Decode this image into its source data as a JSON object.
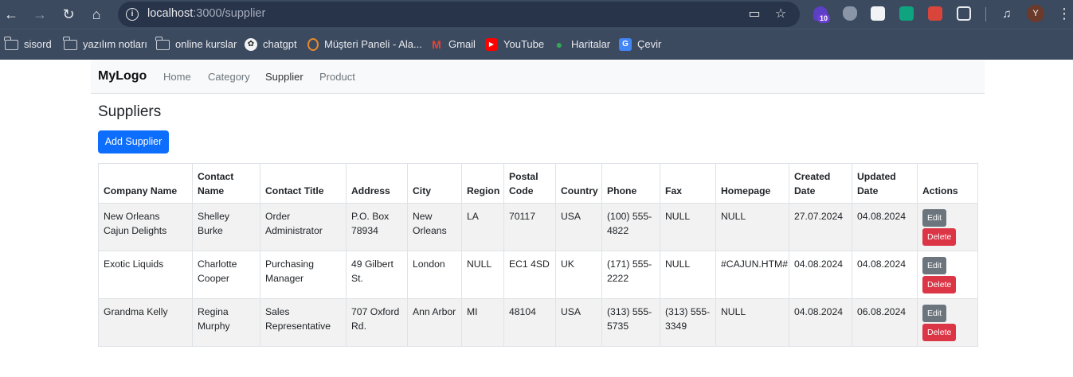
{
  "browser": {
    "url_host": "localhost",
    "url_port_path": ":3000/supplier",
    "extension_badge": "10",
    "profile_initial": "Y",
    "bookmarks": [
      {
        "label": "sisord",
        "icon": "folder-icon"
      },
      {
        "label": "yazılım notları",
        "icon": "folder-icon"
      },
      {
        "label": "online kurslar",
        "icon": "folder-icon"
      },
      {
        "label": "chatgpt",
        "icon": "chatgpt-icon"
      },
      {
        "label": "Müşteri Paneli - Ala...",
        "icon": "panel-icon"
      },
      {
        "label": "Gmail",
        "icon": "gmail-icon"
      },
      {
        "label": "YouTube",
        "icon": "youtube-icon"
      },
      {
        "label": "Haritalar",
        "icon": "maps-icon"
      },
      {
        "label": "Çevir",
        "icon": "translate-icon"
      }
    ]
  },
  "navbar": {
    "brand": "MyLogo",
    "links": [
      "Home",
      "Category",
      "Supplier",
      "Product"
    ],
    "active": "Supplier"
  },
  "page": {
    "title": "Suppliers",
    "add_button": "Add Supplier"
  },
  "table": {
    "headers": [
      "Company Name",
      "Contact Name",
      "Contact Title",
      "Address",
      "City",
      "Region",
      "Postal Code",
      "Country",
      "Phone",
      "Fax",
      "Homepage",
      "Created Date",
      "Updated Date",
      "Actions"
    ],
    "rows": [
      [
        "New Orleans Cajun Delights",
        "Shelley Burke",
        "Order Administrator",
        "P.O. Box 78934",
        "New Orleans",
        "LA",
        "70117",
        "USA",
        "(100) 555-4822",
        "NULL",
        "NULL",
        "27.07.2024",
        "04.08.2024"
      ],
      [
        "Exotic Liquids",
        "Charlotte Cooper",
        "Purchasing Manager",
        "49 Gilbert St.",
        "London",
        "NULL",
        "EC1 4SD",
        "UK",
        "(171) 555-2222",
        "NULL",
        "#CAJUN.HTM#",
        "04.08.2024",
        "04.08.2024"
      ],
      [
        "Grandma Kelly",
        "Regina Murphy",
        "Sales Representative",
        "707 Oxford Rd.",
        "Ann Arbor",
        "MI",
        "48104",
        "USA",
        "(313) 555-5735",
        "(313) 555-3349",
        "NULL",
        "04.08.2024",
        "06.08.2024"
      ]
    ],
    "edit_label": "Edit",
    "delete_label": "Delete"
  },
  "colors": {
    "primary": "#0d6efd",
    "secondary": "#6c757d",
    "danger": "#dc3545",
    "chrome": "#3c4a60"
  }
}
